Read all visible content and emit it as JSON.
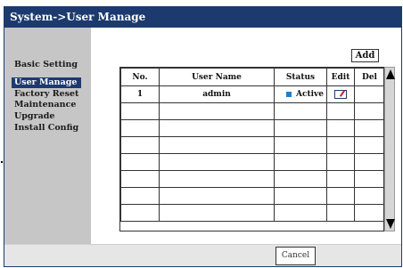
{
  "window": {
    "title": "System->User Manage"
  },
  "sidebar": {
    "items": [
      {
        "label": "Basic Setting",
        "active": false
      },
      {
        "label": "User Manage",
        "active": true
      },
      {
        "label": "Factory Reset",
        "active": false
      },
      {
        "label": "Maintenance",
        "active": false
      },
      {
        "label": "Upgrade",
        "active": false
      },
      {
        "label": "Install Config",
        "active": false
      }
    ]
  },
  "toolbar": {
    "add_label": "Add"
  },
  "table": {
    "headers": [
      "No.",
      "User Name",
      "Status",
      "Edit",
      "Del"
    ],
    "rows": [
      {
        "no": "1",
        "user_name": "admin",
        "status": "Active",
        "status_icon": "status-indicator-icon",
        "edit_icon": "edit-icon"
      }
    ],
    "empty_rows": 7
  },
  "footer": {
    "cancel_label": "Cancel"
  },
  "colors": {
    "title_bar": "#1c3a6e",
    "sidebar_bg": "#c6c6c6",
    "active_menu_bg": "#1c3a6e",
    "status_icon": "#1e7fd0"
  }
}
